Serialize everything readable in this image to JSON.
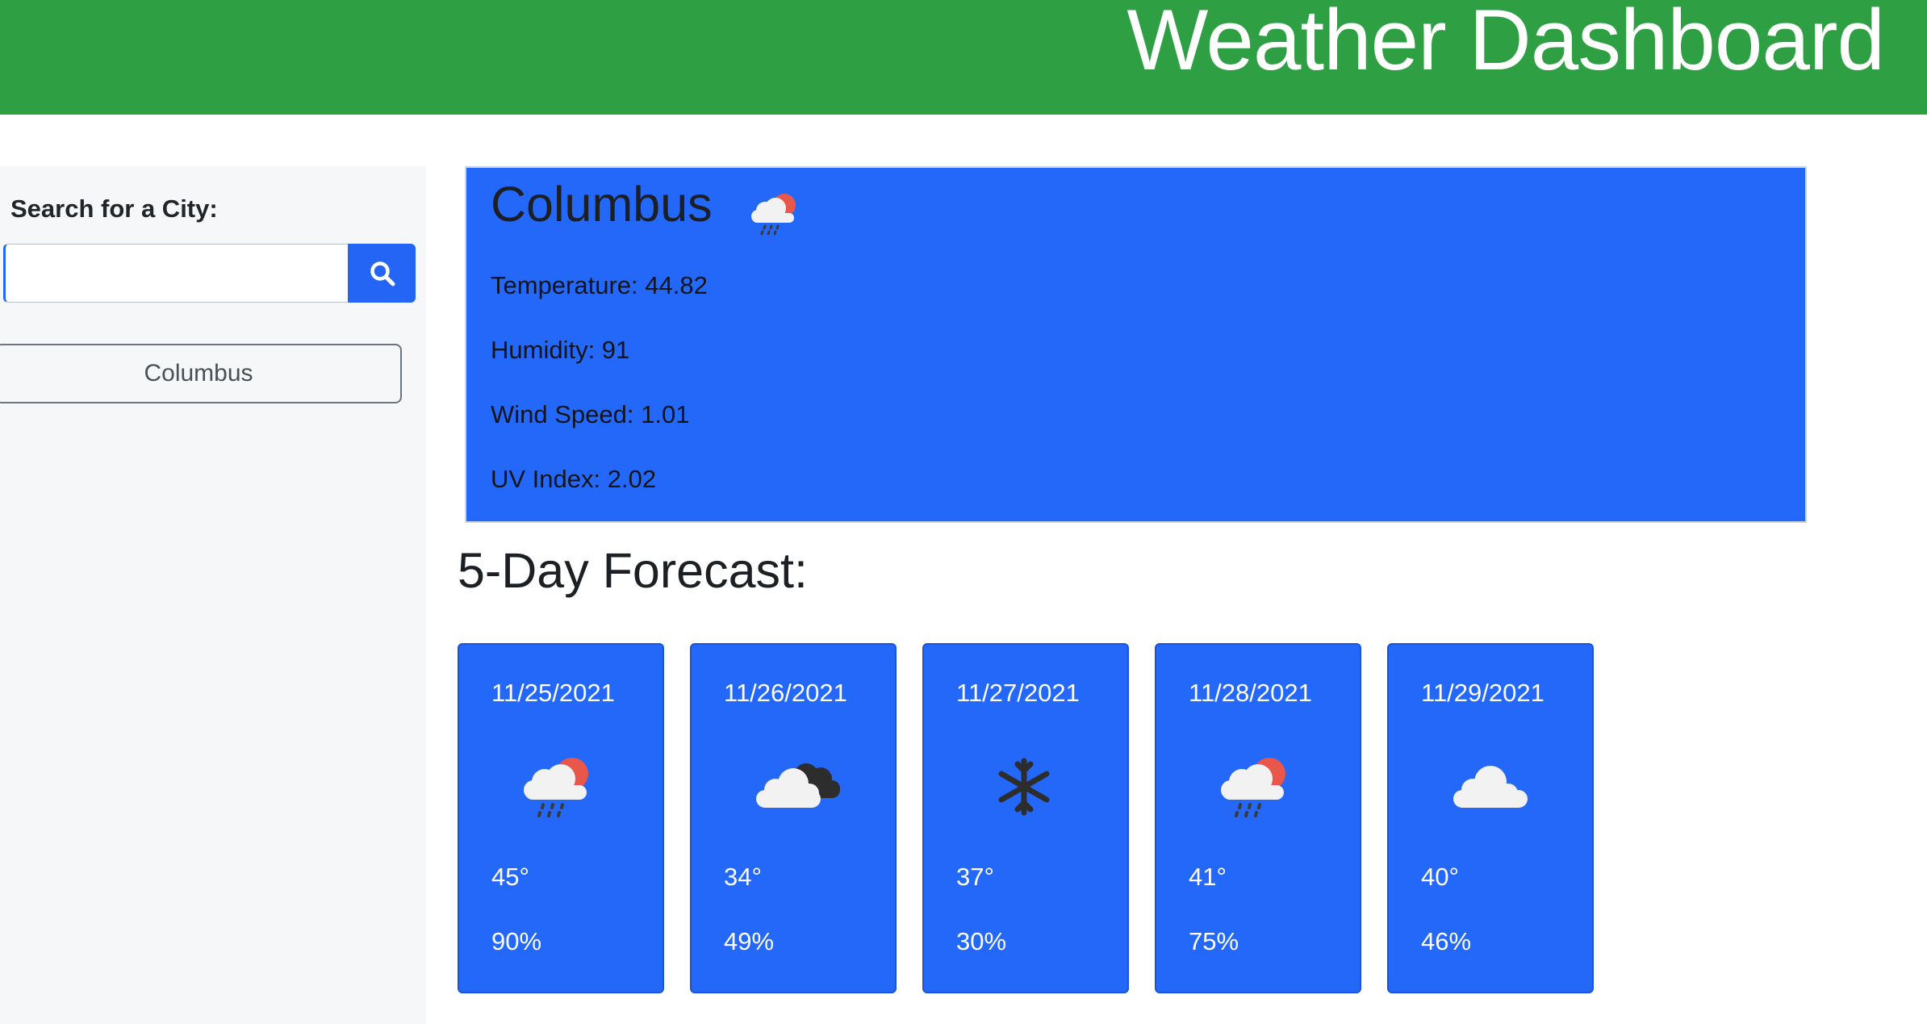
{
  "header": {
    "title": "Weather Dashboard"
  },
  "sidebar": {
    "search_label": "Search for a City:",
    "search_value": "",
    "search_placeholder": "",
    "search_icon": "search-icon",
    "history": [
      "Columbus"
    ]
  },
  "current": {
    "city": "Columbus",
    "icon": "rain-sun-icon",
    "temperature": "Temperature: 44.82",
    "humidity": "Humidity: 91",
    "wind_speed": "Wind Speed: 1.01",
    "uv_index": "UV Index: 2.02"
  },
  "forecast": {
    "title": "5-Day Forecast:",
    "days": [
      {
        "date": "11/25/2021",
        "icon": "rain-sun-icon",
        "temp": "45°",
        "humidity": "90%"
      },
      {
        "date": "11/26/2021",
        "icon": "clouds-icon",
        "temp": "34°",
        "humidity": "49%"
      },
      {
        "date": "11/27/2021",
        "icon": "snowflake-icon",
        "temp": "37°",
        "humidity": "30%"
      },
      {
        "date": "11/28/2021",
        "icon": "rain-sun-icon",
        "temp": "41°",
        "humidity": "75%"
      },
      {
        "date": "11/29/2021",
        "icon": "cloud-icon",
        "temp": "40°",
        "humidity": "46%"
      }
    ]
  },
  "colors": {
    "header_bg": "#2ea043",
    "accent_blue": "#2468fa",
    "sidebar_bg": "#f6f7f8"
  }
}
